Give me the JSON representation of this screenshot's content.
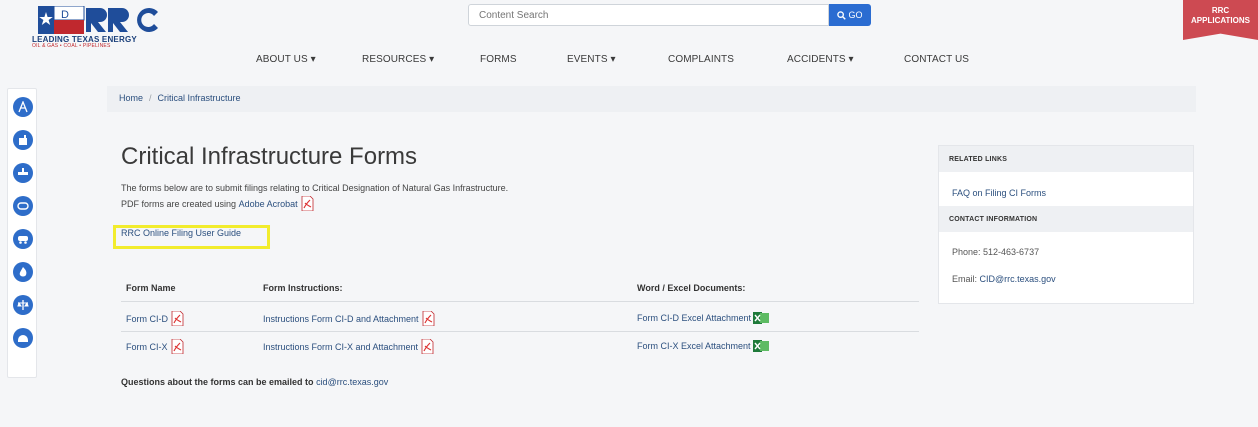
{
  "header": {
    "logo_tagline": "LEADING TEXAS ENERGY",
    "logo_subline": "OIL & GAS • COAL • PIPELINES",
    "search_placeholder": "Content Search",
    "search_button": "GO",
    "apps_line1": "RRC",
    "apps_line2": "APPLICATIONS"
  },
  "nav": {
    "items": [
      "ABOUT US ▾",
      "RESOURCES ▾",
      "FORMS",
      "EVENTS ▾",
      "COMPLAINTS",
      "ACCIDENTS ▾",
      "CONTACT US"
    ]
  },
  "sidebar": {
    "icons": [
      "oil-derrick-icon",
      "factory-icon",
      "pipeline-icon",
      "tank-icon",
      "truck-icon",
      "flame-icon",
      "gavel-icon",
      "storage-icon"
    ]
  },
  "breadcrumb": {
    "home": "Home",
    "separator": "/",
    "current": "Critical Infrastructure"
  },
  "main": {
    "title": "Critical Infrastructure Forms",
    "intro_line1": "The forms below are to submit filings relating to Critical Designation of Natural Gas Infrastructure.",
    "intro_line2_prefix": "PDF forms are created using",
    "intro_line2_link": "Adobe Acrobat",
    "guide_link": "RRC Online Filing User Guide",
    "question_prefix": "Questions about the forms can be emailed to",
    "question_email": "cid@rrc.texas.gov"
  },
  "table": {
    "headers": [
      "Form Name",
      "Form Instructions:",
      "Word / Excel Documents:"
    ],
    "rows": [
      {
        "name": "Form CI-D",
        "instructions": "Instructions Form CI-D and Attachment",
        "excel": "Form CI-D Excel Attachment"
      },
      {
        "name": "Form CI-X",
        "instructions": "Instructions Form CI-X and Attachment",
        "excel": "Form CI-X Excel Attachment"
      }
    ]
  },
  "related": {
    "links_header": "RELATED LINKS",
    "faq_link": "FAQ on Filing CI Forms",
    "contact_header": "CONTACT INFORMATION",
    "phone": "Phone: 512-463-6737",
    "email_prefix": "Email:",
    "email": "CID@rrc.texas.gov"
  },
  "colors": {
    "accent": "#2e6dc9",
    "link": "#2b4f7e",
    "highlight": "#f2ec2d",
    "apps_badge": "#cd4a52"
  }
}
